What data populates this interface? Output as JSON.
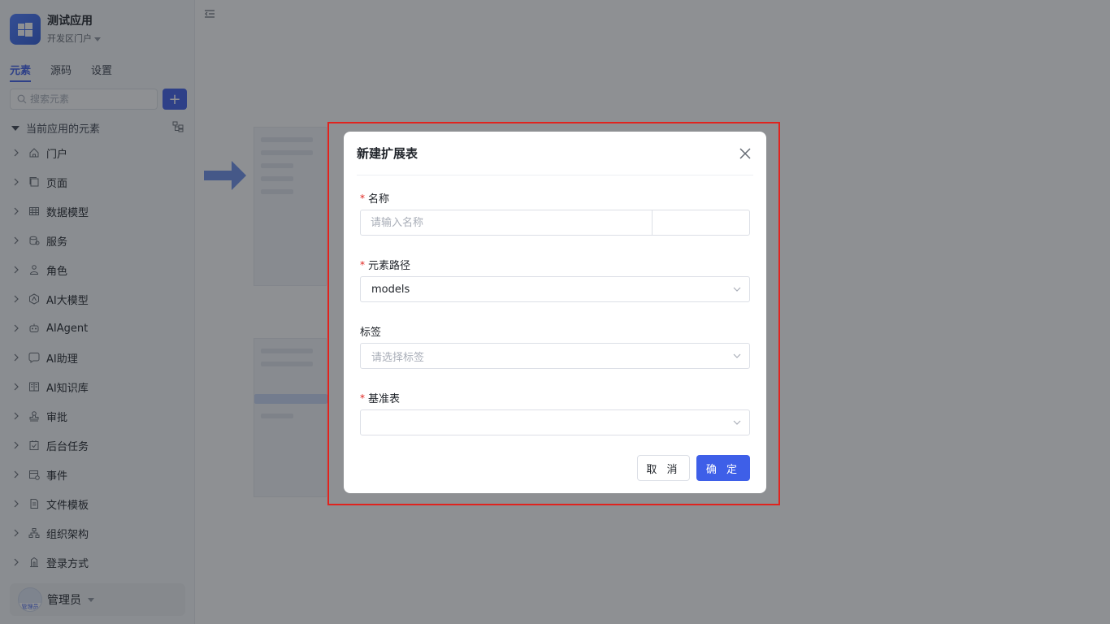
{
  "app": {
    "title": "测试应用",
    "subtitle": "开发区门户"
  },
  "tabs": [
    {
      "label": "元素",
      "active": true
    },
    {
      "label": "源码",
      "active": false
    },
    {
      "label": "设置",
      "active": false
    }
  ],
  "search": {
    "placeholder": "搜索元素",
    "add_label": "+"
  },
  "section": {
    "title": "当前应用的元素"
  },
  "tree": [
    {
      "label": "门户",
      "icon": "home-icon"
    },
    {
      "label": "页面",
      "icon": "page-icon"
    },
    {
      "label": "数据模型",
      "icon": "table-icon"
    },
    {
      "label": "服务",
      "icon": "service-icon"
    },
    {
      "label": "角色",
      "icon": "role-icon"
    },
    {
      "label": "AI大模型",
      "icon": "ai-model-icon"
    },
    {
      "label": "AIAgent",
      "icon": "robot-icon"
    },
    {
      "label": "AI助理",
      "icon": "ai-assistant-icon"
    },
    {
      "label": "AI知识库",
      "icon": "book-icon"
    },
    {
      "label": "审批",
      "icon": "stamp-icon"
    },
    {
      "label": "后台任务",
      "icon": "task-icon"
    },
    {
      "label": "事件",
      "icon": "event-icon"
    },
    {
      "label": "文件模板",
      "icon": "file-icon"
    },
    {
      "label": "组织架构",
      "icon": "org-icon"
    },
    {
      "label": "登录方式",
      "icon": "login-icon"
    }
  ],
  "user": {
    "name": "管理员",
    "avatar_text": "管理员"
  },
  "modal": {
    "title": "新建扩展表",
    "fields": {
      "name": {
        "label": "名称",
        "required": "*",
        "placeholder": "请输入名称",
        "suffix_value": ""
      },
      "path": {
        "label": "元素路径",
        "required": "*",
        "value": "models"
      },
      "tags": {
        "label": "标签",
        "placeholder": "请选择标签"
      },
      "base": {
        "label": "基准表",
        "required": "*",
        "value": ""
      }
    },
    "cancel_label": "取 消",
    "ok_label": "确 定"
  },
  "colors": {
    "accent": "#3e5fe8",
    "required": "#e0231e",
    "highlight": "#e0231e"
  }
}
